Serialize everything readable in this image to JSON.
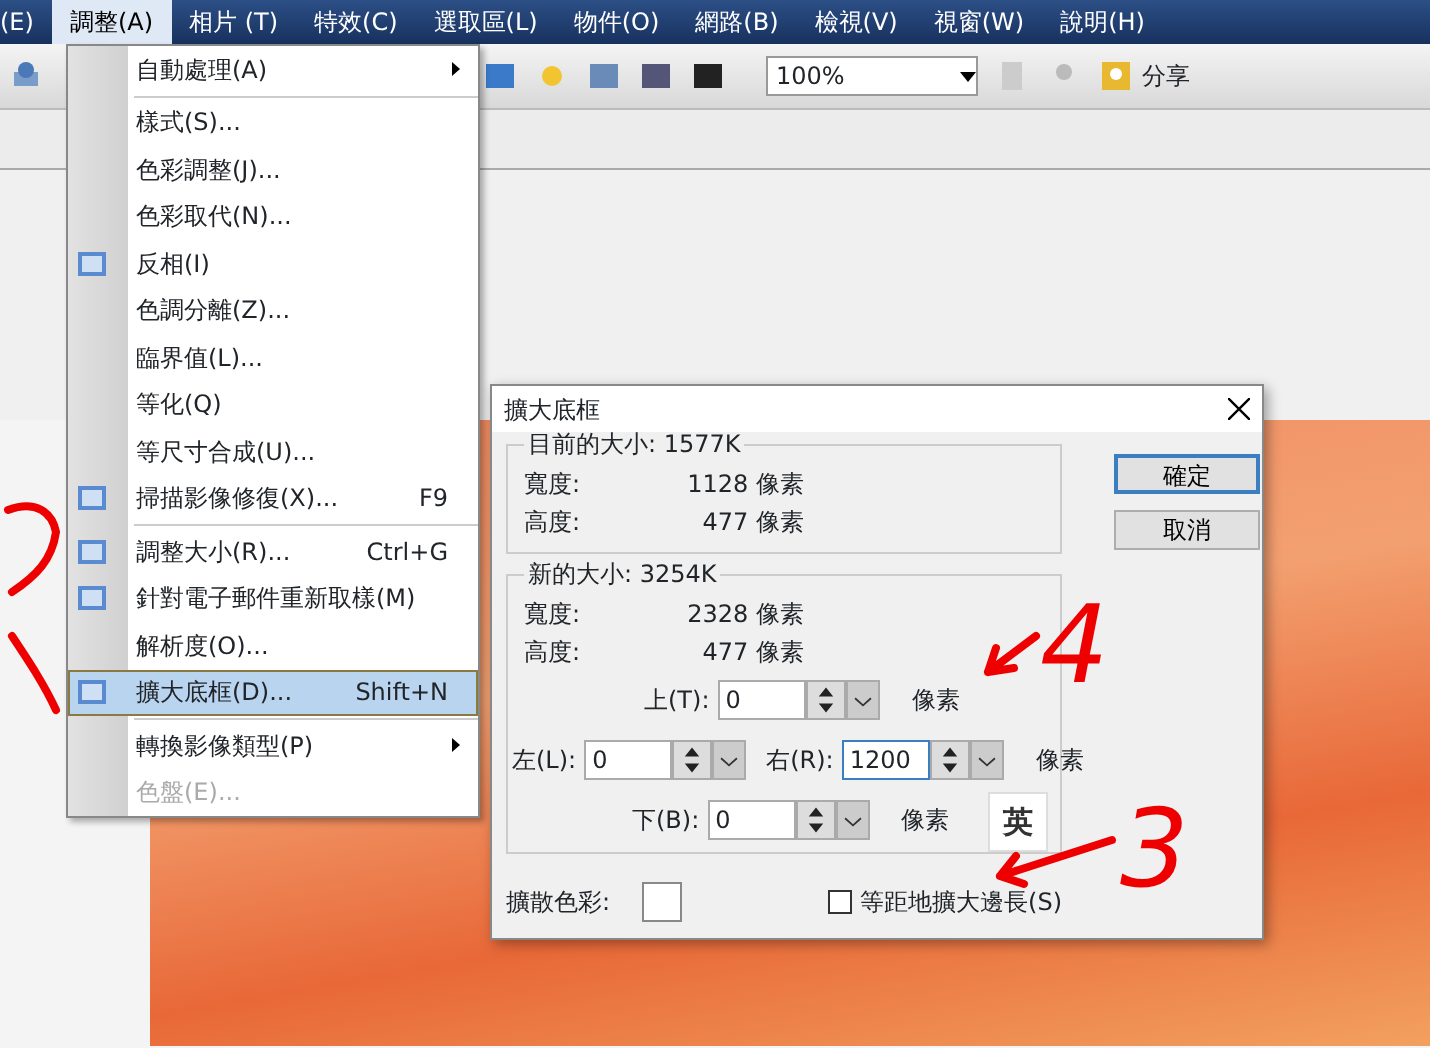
{
  "menubar": [
    {
      "label": "(E)",
      "open": false
    },
    {
      "label": "調整(A)",
      "open": true
    },
    {
      "label": "相片 (T)",
      "open": false
    },
    {
      "label": "特效(C)",
      "open": false
    },
    {
      "label": "選取區(L)",
      "open": false
    },
    {
      "label": "物件(O)",
      "open": false
    },
    {
      "label": "網路(B)",
      "open": false
    },
    {
      "label": "檢視(V)",
      "open": false
    },
    {
      "label": "視窗(W)",
      "open": false
    },
    {
      "label": "說明(H)",
      "open": false
    }
  ],
  "toolbar": {
    "zoom": "100%",
    "share": "分享"
  },
  "menu": {
    "items": [
      {
        "kind": "item",
        "label": "自動處理(A)",
        "icon": false,
        "submenu": true,
        "selected": false,
        "disabled": false
      },
      {
        "kind": "separator"
      },
      {
        "kind": "item",
        "label": "樣式(S)...",
        "icon": false,
        "submenu": false,
        "selected": false,
        "disabled": false
      },
      {
        "kind": "item",
        "label": "色彩調整(J)...",
        "icon": false,
        "submenu": false,
        "selected": false,
        "disabled": false
      },
      {
        "kind": "item",
        "label": "色彩取代(N)...",
        "icon": false,
        "submenu": false,
        "selected": false,
        "disabled": false
      },
      {
        "kind": "item",
        "label": "反相(I)",
        "icon": true,
        "submenu": false,
        "selected": false,
        "disabled": false
      },
      {
        "kind": "item",
        "label": "色調分離(Z)...",
        "icon": false,
        "submenu": false,
        "selected": false,
        "disabled": false
      },
      {
        "kind": "item",
        "label": "臨界值(L)...",
        "icon": false,
        "submenu": false,
        "selected": false,
        "disabled": false
      },
      {
        "kind": "item",
        "label": "等化(Q)",
        "icon": false,
        "submenu": false,
        "selected": false,
        "disabled": false
      },
      {
        "kind": "item",
        "label": "等尺寸合成(U)...",
        "icon": false,
        "submenu": false,
        "selected": false,
        "disabled": false
      },
      {
        "kind": "item",
        "label": "掃描影像修復(X)...",
        "shortcut": "F9",
        "icon": true,
        "submenu": false,
        "selected": false,
        "disabled": false
      },
      {
        "kind": "separator"
      },
      {
        "kind": "item",
        "label": "調整大小(R)...",
        "shortcut": "Ctrl+G",
        "icon": true,
        "submenu": false,
        "selected": false,
        "disabled": false
      },
      {
        "kind": "item",
        "label": "針對電子郵件重新取樣(M)",
        "icon": true,
        "submenu": false,
        "selected": false,
        "disabled": false
      },
      {
        "kind": "item",
        "label": "解析度(O)...",
        "icon": false,
        "submenu": false,
        "selected": false,
        "disabled": false
      },
      {
        "kind": "item",
        "label": "擴大底框(D)...",
        "shortcut": "Shift+N",
        "icon": true,
        "submenu": false,
        "selected": true,
        "disabled": false
      },
      {
        "kind": "separator"
      },
      {
        "kind": "item",
        "label": "轉換影像類型(P)",
        "icon": false,
        "submenu": true,
        "selected": false,
        "disabled": false
      },
      {
        "kind": "item",
        "label": "色盤(E)...",
        "icon": false,
        "submenu": false,
        "selected": false,
        "disabled": true
      }
    ]
  },
  "dialog": {
    "title": "擴大底框",
    "current_size": {
      "legend": "目前的大小: 1577K",
      "rows": [
        {
          "label": "寬度:",
          "value": "1128 像素"
        },
        {
          "label": "高度:",
          "value": "477 像素"
        }
      ]
    },
    "new_size": {
      "legend": "新的大小: 3254K",
      "rows": [
        {
          "label": "寬度:",
          "value": "2328 像素"
        },
        {
          "label": "高度:",
          "value": "477 像素"
        }
      ]
    },
    "top": {
      "label": "上(T):",
      "value": "0",
      "unit": "像素"
    },
    "left": {
      "label": "左(L):",
      "value": "0"
    },
    "right": {
      "label": "右(R):",
      "value": "1200",
      "unit": "像素"
    },
    "bottom": {
      "label": "下(B):",
      "value": "0",
      "unit": "像素"
    },
    "ime": "英",
    "fill_color_label": "擴散色彩:",
    "checkbox": {
      "label": "等距地擴大邊長(S)",
      "checked": false
    },
    "buttons": [
      {
        "label": "確定",
        "selected": true
      },
      {
        "label": "取消",
        "selected": false
      }
    ]
  },
  "annotations": [
    {
      "text": "4"
    },
    {
      "text": "3"
    }
  ]
}
